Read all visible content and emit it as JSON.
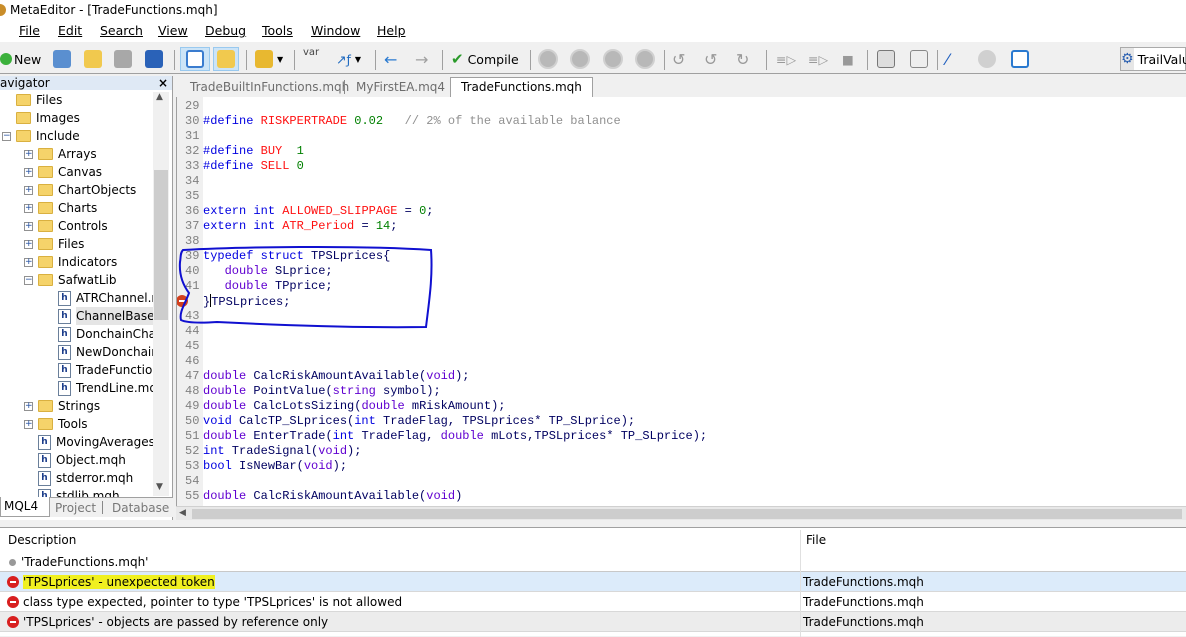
{
  "window": {
    "title": "MetaEditor - [TradeFunctions.mqh]"
  },
  "menu": [
    "File",
    "Edit",
    "Search",
    "View",
    "Debug",
    "Tools",
    "Window",
    "Help"
  ],
  "toolbar": {
    "new_label": "New",
    "compile_label": "Compile",
    "var_label": "var",
    "search_value": "TrailValu"
  },
  "navigator": {
    "title": "avigator",
    "close": "×",
    "items": [
      {
        "label": "Files",
        "type": "folder",
        "level": 0
      },
      {
        "label": "Images",
        "type": "folder",
        "level": 0
      },
      {
        "label": "Include",
        "type": "folder-open",
        "level": 0,
        "expander": "−"
      },
      {
        "label": "Arrays",
        "type": "folder",
        "level": 1,
        "expander": "+"
      },
      {
        "label": "Canvas",
        "type": "folder",
        "level": 1,
        "expander": "+"
      },
      {
        "label": "ChartObjects",
        "type": "folder",
        "level": 1,
        "expander": "+"
      },
      {
        "label": "Charts",
        "type": "folder",
        "level": 1,
        "expander": "+"
      },
      {
        "label": "Controls",
        "type": "folder",
        "level": 1,
        "expander": "+"
      },
      {
        "label": "Files",
        "type": "folder",
        "level": 1,
        "expander": "+"
      },
      {
        "label": "Indicators",
        "type": "folder",
        "level": 1,
        "expander": "+"
      },
      {
        "label": "SafwatLib",
        "type": "folder-open",
        "level": 1,
        "expander": "−"
      },
      {
        "label": "ATRChannel.m",
        "type": "file",
        "level": 2
      },
      {
        "label": "ChannelBase.",
        "type": "file",
        "level": 2
      },
      {
        "label": "DonchainCha",
        "type": "file",
        "level": 2
      },
      {
        "label": "NewDonchain",
        "type": "file",
        "level": 2
      },
      {
        "label": "TradeFunction",
        "type": "file",
        "level": 2
      },
      {
        "label": "TrendLine.mq",
        "type": "file",
        "level": 2
      },
      {
        "label": "Strings",
        "type": "folder",
        "level": 1,
        "expander": "+"
      },
      {
        "label": "Tools",
        "type": "folder",
        "level": 1,
        "expander": "+"
      },
      {
        "label": "MovingAverages.",
        "type": "file",
        "level": 1
      },
      {
        "label": "Object.mqh",
        "type": "file",
        "level": 1
      },
      {
        "label": "stderror.mqh",
        "type": "file",
        "level": 1
      },
      {
        "label": "stdlib.mqh",
        "type": "file",
        "level": 1
      }
    ],
    "tabs": [
      "MQL4",
      "Project",
      "Database"
    ]
  },
  "editor": {
    "tabs": [
      "TradeBuiltInFunctions.mqh",
      "MyFirstEA.mq4",
      "TradeFunctions.mqh"
    ],
    "active_tab": 2,
    "lines": [
      {
        "n": "29",
        "t": []
      },
      {
        "n": "30",
        "t": [
          [
            "k",
            "#define"
          ],
          [
            "m",
            " RISKPERTRADE"
          ],
          [
            "n",
            " 0.02"
          ],
          [
            "c",
            "   // 2% of the available balance"
          ]
        ]
      },
      {
        "n": "31",
        "t": []
      },
      {
        "n": "32",
        "t": [
          [
            "k",
            "#define"
          ],
          [
            "m",
            " BUY"
          ],
          [
            "n",
            "  1"
          ]
        ]
      },
      {
        "n": "33",
        "t": [
          [
            "k",
            "#define"
          ],
          [
            "m",
            " SELL"
          ],
          [
            "n",
            " 0"
          ]
        ]
      },
      {
        "n": "34",
        "t": []
      },
      {
        "n": "35",
        "t": []
      },
      {
        "n": "36",
        "t": [
          [
            "k",
            "extern"
          ],
          [
            "k",
            " int"
          ],
          [
            "m",
            " ALLOWED_SLIPPAGE"
          ],
          [
            "p",
            " = "
          ],
          [
            "n",
            "0"
          ],
          [
            "p",
            ";"
          ]
        ]
      },
      {
        "n": "37",
        "t": [
          [
            "k",
            "extern"
          ],
          [
            "k",
            " int"
          ],
          [
            "m",
            " ATR_Period"
          ],
          [
            "p",
            " = "
          ],
          [
            "n",
            "14"
          ],
          [
            "p",
            ";"
          ]
        ]
      },
      {
        "n": "38",
        "t": []
      },
      {
        "n": "39",
        "t": [
          [
            "k",
            "typedef"
          ],
          [
            "k",
            " struct"
          ],
          [
            "i",
            " TPSLprices"
          ],
          [
            "p",
            "{"
          ]
        ]
      },
      {
        "n": "40",
        "t": [
          [
            "t",
            "   double"
          ],
          [
            "i",
            " SLprice"
          ],
          [
            "p",
            ";"
          ]
        ]
      },
      {
        "n": "41",
        "t": [
          [
            "t",
            "   double"
          ],
          [
            "i",
            " TPprice"
          ],
          [
            "p",
            ";"
          ]
        ]
      },
      {
        "n": "42",
        "error": true,
        "t": [
          [
            "p",
            "}"
          ],
          [
            "i",
            "TPSLprices"
          ],
          [
            "p",
            ";"
          ]
        ]
      },
      {
        "n": "43",
        "t": []
      },
      {
        "n": "44",
        "t": []
      },
      {
        "n": "45",
        "t": []
      },
      {
        "n": "46",
        "t": []
      },
      {
        "n": "47",
        "t": [
          [
            "t",
            "double"
          ],
          [
            "i",
            " CalcRiskAmountAvailable"
          ],
          [
            "p",
            "("
          ],
          [
            "t",
            "void"
          ],
          [
            "p",
            ");"
          ]
        ]
      },
      {
        "n": "48",
        "t": [
          [
            "t",
            "double"
          ],
          [
            "i",
            " PointValue"
          ],
          [
            "p",
            "("
          ],
          [
            "t",
            "string"
          ],
          [
            "i",
            " symbol"
          ],
          [
            "p",
            ");"
          ]
        ]
      },
      {
        "n": "49",
        "t": [
          [
            "t",
            "double"
          ],
          [
            "i",
            " CalcLotsSizing"
          ],
          [
            "p",
            "("
          ],
          [
            "t",
            "double"
          ],
          [
            "i",
            " mRiskAmount"
          ],
          [
            "p",
            ");"
          ]
        ]
      },
      {
        "n": "50",
        "t": [
          [
            "k",
            "void"
          ],
          [
            "i",
            " CalcTP_SLprices"
          ],
          [
            "p",
            "("
          ],
          [
            "k",
            "int"
          ],
          [
            "i",
            " TradeFlag, TPSLprices"
          ],
          [
            "p",
            "*"
          ],
          [
            "i",
            " TP_SLprice"
          ],
          [
            "p",
            ");"
          ]
        ]
      },
      {
        "n": "51",
        "t": [
          [
            "t",
            "double"
          ],
          [
            "i",
            " EnterTrade"
          ],
          [
            "p",
            "("
          ],
          [
            "k",
            "int"
          ],
          [
            "i",
            " TradeFlag, "
          ],
          [
            "t",
            "double"
          ],
          [
            "i",
            " mLots,TPSLprices"
          ],
          [
            "p",
            "*"
          ],
          [
            "i",
            " TP_SLprice"
          ],
          [
            "p",
            ");"
          ]
        ]
      },
      {
        "n": "52",
        "t": [
          [
            "k",
            "int"
          ],
          [
            "i",
            " TradeSignal"
          ],
          [
            "p",
            "("
          ],
          [
            "t",
            "void"
          ],
          [
            "p",
            ");"
          ]
        ]
      },
      {
        "n": "53",
        "t": [
          [
            "k",
            "bool"
          ],
          [
            "i",
            " IsNewBar"
          ],
          [
            "p",
            "("
          ],
          [
            "t",
            "void"
          ],
          [
            "p",
            ");"
          ]
        ]
      },
      {
        "n": "54",
        "t": []
      },
      {
        "n": "55",
        "t": [
          [
            "t",
            "double"
          ],
          [
            "i",
            " CalcRiskAmountAvailable"
          ],
          [
            "p",
            "("
          ],
          [
            "t",
            "void"
          ],
          [
            "p",
            ")"
          ]
        ]
      }
    ]
  },
  "errors": {
    "columns": [
      "Description",
      "File"
    ],
    "header_row": "'TradeFunctions.mqh'",
    "rows": [
      {
        "description": "'TPSLprices' - unexpected token",
        "file": "TradeFunctions.mqh",
        "highlight": "#f0f020"
      },
      {
        "description": "class type expected, pointer to type 'TPSLprices' is not allowed",
        "file": "TradeFunctions.mqh"
      },
      {
        "description": "'TPSLprices' - objects are passed by reference only",
        "file": "TradeFunctions.mqh"
      }
    ]
  },
  "colors": {
    "annotation": "#1010d0",
    "selected_row": "#dcebfa",
    "error": "#d82020"
  }
}
